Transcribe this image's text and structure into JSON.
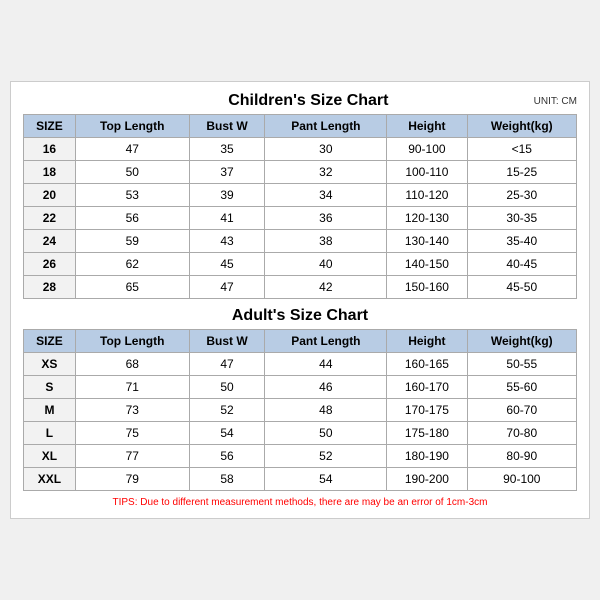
{
  "unit": "UNIT: CM",
  "children_title": "Children's Size Chart",
  "adult_title": "Adult's Size Chart",
  "columns": [
    "SIZE",
    "Top Length",
    "Bust W",
    "Pant Length",
    "Height",
    "Weight(kg)"
  ],
  "children_rows": [
    [
      "16",
      "47",
      "35",
      "30",
      "90-100",
      "<15"
    ],
    [
      "18",
      "50",
      "37",
      "32",
      "100-110",
      "15-25"
    ],
    [
      "20",
      "53",
      "39",
      "34",
      "110-120",
      "25-30"
    ],
    [
      "22",
      "56",
      "41",
      "36",
      "120-130",
      "30-35"
    ],
    [
      "24",
      "59",
      "43",
      "38",
      "130-140",
      "35-40"
    ],
    [
      "26",
      "62",
      "45",
      "40",
      "140-150",
      "40-45"
    ],
    [
      "28",
      "65",
      "47",
      "42",
      "150-160",
      "45-50"
    ]
  ],
  "adult_rows": [
    [
      "XS",
      "68",
      "47",
      "44",
      "160-165",
      "50-55"
    ],
    [
      "S",
      "71",
      "50",
      "46",
      "160-170",
      "55-60"
    ],
    [
      "M",
      "73",
      "52",
      "48",
      "170-175",
      "60-70"
    ],
    [
      "L",
      "75",
      "54",
      "50",
      "175-180",
      "70-80"
    ],
    [
      "XL",
      "77",
      "56",
      "52",
      "180-190",
      "80-90"
    ],
    [
      "XXL",
      "79",
      "58",
      "54",
      "190-200",
      "90-100"
    ]
  ],
  "tips": "TIPS: Due to different measurement methods, there are may be an error of 1cm-3cm"
}
